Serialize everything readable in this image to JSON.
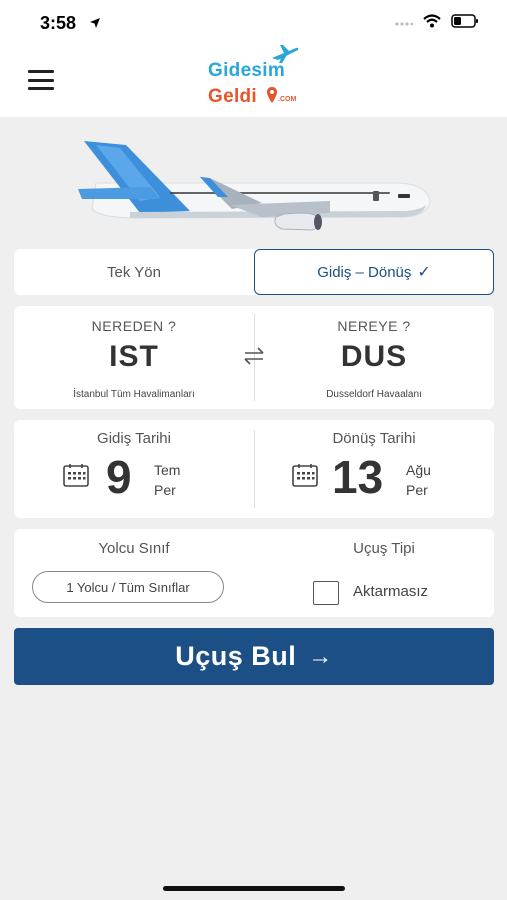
{
  "status_bar": {
    "time": "3:58",
    "location_icon": "location-arrow-icon",
    "signal_icon": "cellular-signal-icon",
    "wifi_icon": "wifi-icon",
    "battery_icon": "battery-icon"
  },
  "header": {
    "menu_icon": "hamburger-menu-icon",
    "logo_line1": "Gidesim",
    "logo_line2": "Geldi",
    "logo_suffix": ".COM"
  },
  "trip_type": {
    "one_way_label": "Tek Yön",
    "round_trip_label": "Gidiş – Dönüş",
    "selected": "round_trip",
    "check_icon": "check-icon"
  },
  "route": {
    "from_label": "NEREDEN ?",
    "from_code": "IST",
    "from_airport": "İstanbul Tüm Havalimanları",
    "to_label": "NEREYE ?",
    "to_code": "DUS",
    "to_airport": "Dusseldorf Havaalanı",
    "swap_icon": "swap-arrows-icon"
  },
  "dates": {
    "departure_title": "Gidiş Tarihi",
    "departure_day": "9",
    "departure_month": "Tem",
    "departure_weekday": "Per",
    "return_title": "Dönüş Tarihi",
    "return_day": "13",
    "return_month": "Ağu",
    "return_weekday": "Per",
    "calendar_icon": "calendar-icon"
  },
  "passengers": {
    "title": "Yolcu Sınıf",
    "value": "1 Yolcu / Tüm Sınıflar"
  },
  "flight_type": {
    "title": "Uçuş Tipi",
    "nonstop_label": "Aktarmasız",
    "nonstop_checked": false
  },
  "search_button": {
    "label": "Uçuş Bul",
    "arrow": "→"
  },
  "colors": {
    "primary": "#1c4f86",
    "logo_blue": "#2aa7d8",
    "logo_orange": "#e8552a",
    "background": "#efefef"
  }
}
